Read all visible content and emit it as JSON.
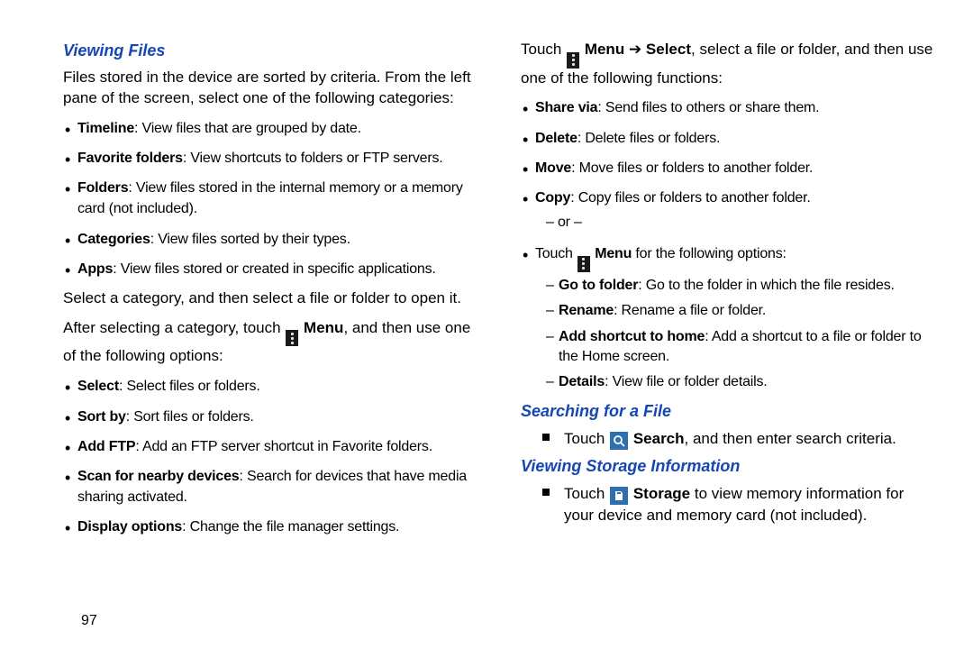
{
  "page_number": "97",
  "left": {
    "heading1": "Viewing Files",
    "intro": "Files stored in the device are sorted by criteria. From the left pane of the screen, select one of the following categories:",
    "cats": [
      {
        "b": "Timeline",
        "t": ": View files that are grouped by date."
      },
      {
        "b": "Favorite folders",
        "t": ": View shortcuts to folders or FTP servers."
      },
      {
        "b": "Folders",
        "t": ": View files stored in the internal memory or a memory card (not included)."
      },
      {
        "b": "Categories",
        "t": ": View files sorted by their types."
      },
      {
        "b": "Apps",
        "t": ": View files stored or created in specific applications."
      }
    ],
    "mid1": "Select a category, and then select a file or folder to open it.",
    "mid2a": "After selecting a category, touch ",
    "mid2b": " Menu",
    "mid2c": ", and then use one of the following options:",
    "opts": [
      {
        "b": "Select",
        "t": ": Select files or folders."
      },
      {
        "b": "Sort by",
        "t": ": Sort files or folders."
      },
      {
        "b": "Add FTP",
        "t": ": Add an FTP server shortcut in Favorite folders."
      },
      {
        "b": "Scan for nearby devices",
        "t": ": Search for devices that have media sharing activated."
      },
      {
        "b": "Display options",
        "t": ": Change the file manager settings."
      }
    ]
  },
  "right": {
    "top_a": "Touch ",
    "top_b": " Menu ",
    "top_arrow": "➔",
    "top_c": " Select",
    "top_d": ", select a file or folder, and then use one of the following functions:",
    "funcs": [
      {
        "b": "Share via",
        "t": ": Send files to others or share them."
      },
      {
        "b": "Delete",
        "t": ": Delete files or folders."
      },
      {
        "b": "Move",
        "t": ": Move files or folders to another folder."
      },
      {
        "b": "Copy",
        "t": ": Copy files or folders to another folder."
      }
    ],
    "or_text": "– or –",
    "touch_menu_a": "Touch ",
    "touch_menu_b": " Menu",
    "touch_menu_c": " for the following options:",
    "subopts": [
      {
        "b": "Go to folder",
        "t": ": Go to the folder in which the file resides."
      },
      {
        "b": "Rename",
        "t": ": Rename a file or folder."
      },
      {
        "b": "Add shortcut to home",
        "t": ": Add a shortcut to a file or folder to the Home screen."
      },
      {
        "b": "Details",
        "t": ": View file or folder details."
      }
    ],
    "heading2": "Searching for a File",
    "search_a": "Touch ",
    "search_b": " Search",
    "search_c": ", and then enter search criteria.",
    "heading3": "Viewing Storage Information",
    "storage_a": "Touch ",
    "storage_b": " Storage",
    "storage_c": " to view memory information for your device and memory card (not included)."
  }
}
